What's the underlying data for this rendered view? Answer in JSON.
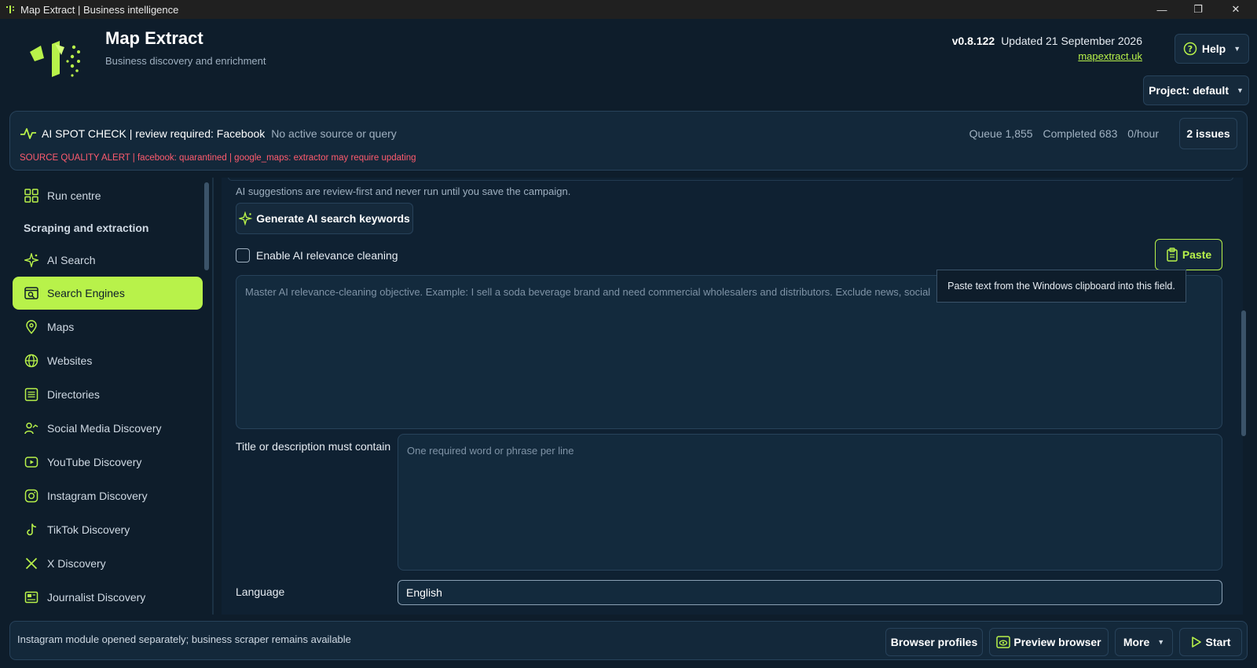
{
  "window": {
    "title": "Map Extract | Business intelligence",
    "minimize": "—",
    "maximize": "❐",
    "close": "✕"
  },
  "header": {
    "app_name": "Map Extract",
    "subtitle": "Business discovery and enrichment",
    "version": "v0.8.122",
    "updated": "Updated 21 September 2026",
    "site_link": "mapextract.uk",
    "help_label": "Help",
    "project_label": "Project: default"
  },
  "status": {
    "spot_check": "AI SPOT CHECK | review required: Facebook",
    "spot_sub": "No active source or query",
    "alert": "SOURCE QUALITY ALERT | facebook: quarantined | google_maps: extractor may require updating",
    "queue": "Queue 1,855",
    "completed": "Completed 683",
    "rate": "0/hour",
    "issues_label": "2 issues"
  },
  "sidebar": {
    "items": [
      {
        "label": "Run centre",
        "icon": "grid-icon"
      },
      {
        "label": "AI Search",
        "icon": "sparkle-icon"
      },
      {
        "label": "Search Engines",
        "icon": "search-window-icon"
      },
      {
        "label": "Maps",
        "icon": "pin-icon"
      },
      {
        "label": "Websites",
        "icon": "globe-icon"
      },
      {
        "label": "Directories",
        "icon": "list-icon"
      },
      {
        "label": "Social Media Discovery",
        "icon": "user-trend-icon"
      },
      {
        "label": "YouTube Discovery",
        "icon": "play-icon"
      },
      {
        "label": "Instagram Discovery",
        "icon": "instagram-icon"
      },
      {
        "label": "TikTok Discovery",
        "icon": "music-note-icon"
      },
      {
        "label": "X Discovery",
        "icon": "x-icon"
      },
      {
        "label": "Journalist Discovery",
        "icon": "newspaper-icon"
      }
    ],
    "section_scraping": "Scraping and extraction"
  },
  "main": {
    "hint": "AI suggestions are review-first and never run until you save the campaign.",
    "generate_label": "Generate AI search keywords",
    "enable_cleaning_label": "Enable AI relevance cleaning",
    "paste_label": "Paste",
    "objective_placeholder": "Master AI relevance-cleaning objective. Example: I sell a soda beverage brand and need commercial wholesalers and distributors. Exclude news, social",
    "objective_tail": "cial",
    "tooltip": "Paste text from the Windows clipboard into this field.",
    "must_contain_label": "Title or description must contain",
    "must_contain_placeholder": "One required word or phrase per line",
    "language_label": "Language",
    "language_value": "English"
  },
  "footer": {
    "message": "Instagram module opened separately; business scraper remains available",
    "browser_profiles": "Browser profiles",
    "preview_browser": "Preview browser",
    "more": "More",
    "start": "Start"
  },
  "colors": {
    "accent": "#b8f24a",
    "background": "#0e1d2b",
    "alert": "#ff5b6e"
  }
}
